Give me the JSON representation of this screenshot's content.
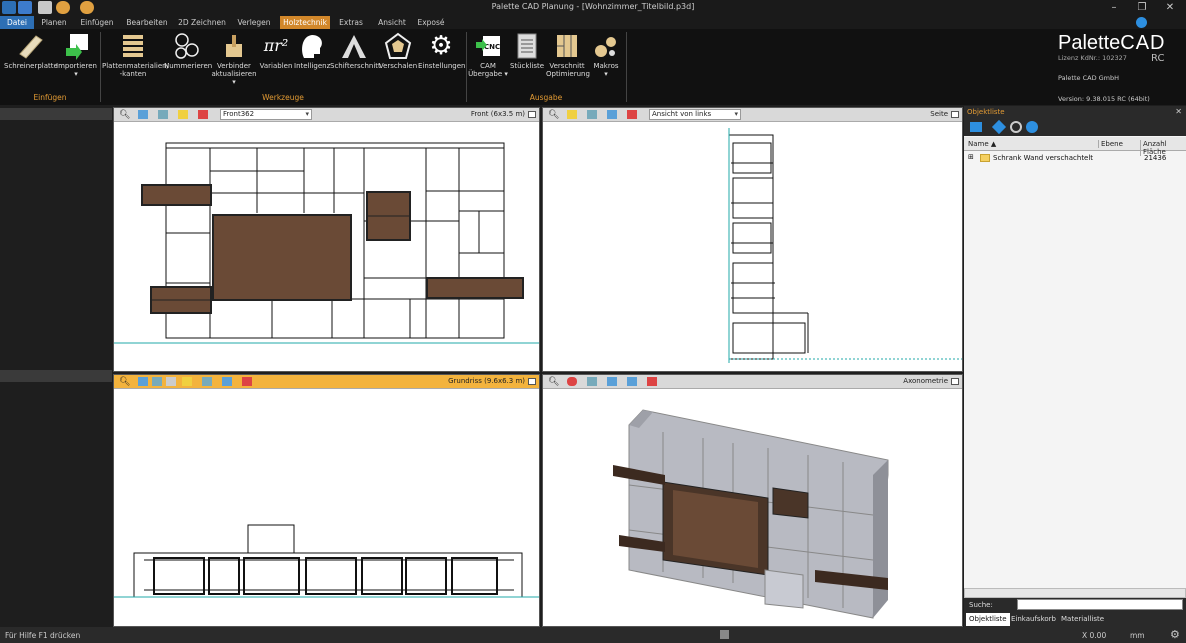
{
  "app": {
    "title": "Palette CAD Planung - [Wohnzimmer_Titelbild.p3d]"
  },
  "tabs": [
    {
      "label": "Datei"
    },
    {
      "label": "Planen"
    },
    {
      "label": "Einfügen"
    },
    {
      "label": "Bearbeiten"
    },
    {
      "label": "2D Zeichnen"
    },
    {
      "label": "Verlegen"
    },
    {
      "label": "Holztechnik"
    },
    {
      "label": "Extras"
    },
    {
      "label": "Ansicht"
    },
    {
      "label": "Exposé"
    }
  ],
  "active_tab": "Holztechnik",
  "ribbon": {
    "buttons": [
      {
        "label": "Schreinerplatte",
        "icon": "board-icon"
      },
      {
        "label": "Importieren",
        "sub": "▾",
        "icon": "import-icon"
      },
      {
        "label": "Plattenmaterialien/",
        "sub": "-kanten",
        "icon": "panel-materials-icon"
      },
      {
        "label": "Nummerieren",
        "icon": "numbering-icon"
      },
      {
        "label": "Verbinder",
        "sub": "aktualisieren ▾",
        "icon": "connector-icon"
      },
      {
        "label": "Variablen",
        "icon": "variables-icon"
      },
      {
        "label": "Intelligenz",
        "icon": "intelligence-icon"
      },
      {
        "label": "Schifterschnitt",
        "icon": "miter-cut-icon"
      },
      {
        "label": "Verschalen",
        "icon": "cladding-icon"
      },
      {
        "label": "Einstellungen",
        "icon": "gear-icon"
      },
      {
        "label": "CAM",
        "sub": "Übergabe ▾",
        "icon": "cnc-icon"
      },
      {
        "label": "Stückliste",
        "icon": "parts-list-icon"
      },
      {
        "label": "Verschnitt",
        "sub": "Optimierung",
        "icon": "cut-optimization-icon"
      },
      {
        "label": "Makros",
        "sub": "▾",
        "icon": "macros-icon"
      }
    ],
    "groups": [
      {
        "label": "Einfügen"
      },
      {
        "label": "Werkzeuge"
      },
      {
        "label": "Ausgabe"
      }
    ]
  },
  "brand": {
    "logo_a": "Palette",
    "logo_b": "CAD",
    "suffix": "RC",
    "license": "Lizenz KdNr.: 102327",
    "company": "Palette CAD GmbH",
    "version": "Version: 9.38.015 RC (64bit)"
  },
  "viewports": {
    "front": {
      "dropdown": "Front362",
      "label": "Front  (6x3.5 m)"
    },
    "side": {
      "dropdown": "Ansicht von links",
      "label": "Seite"
    },
    "plan": {
      "label": "Grundriss  (9.6x6.3 m)"
    },
    "axo": {
      "label": "Axonometrie"
    }
  },
  "objectlist": {
    "title": "Objektliste",
    "columns": [
      "Name ▲",
      "Ebene",
      "Anzahl Fläche"
    ],
    "rows": [
      {
        "name": "Schrank Wand verschachtelt",
        "count": "21436"
      }
    ],
    "search_label": "Suche:",
    "tabs": [
      "Objektliste",
      "Einkaufskorb",
      "Materialliste"
    ]
  },
  "status": {
    "help": "Für Hilfe F1 drücken",
    "coord": "X 0.00",
    "unit": "mm"
  },
  "colors": {
    "accent": "#d2872a",
    "file_tab": "#2d6fb5",
    "wood": "#5a4030"
  }
}
